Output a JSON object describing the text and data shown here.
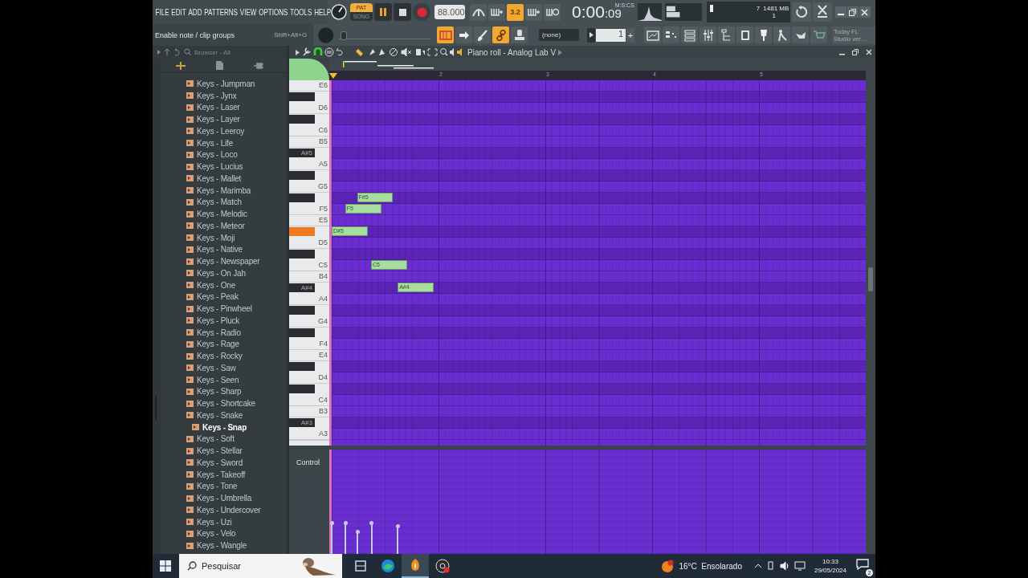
{
  "menu": [
    "FILE",
    "EDIT",
    "ADD",
    "PATTERNS",
    "VIEW",
    "OPTIONS",
    "TOOLS",
    "HELP"
  ],
  "hint": {
    "text": "Enable note / clip groups",
    "shortcut": "Shift+Alt+G"
  },
  "transport": {
    "modes": [
      {
        "label": "PAT",
        "selected": true
      },
      {
        "label": "SONG",
        "selected": false
      }
    ],
    "tempo": "88.000",
    "recording": false
  },
  "master_pitch": {
    "level": 0.02
  },
  "top_buttons": [
    {
      "kind": "metronome",
      "on": false
    },
    {
      "kind": "wait",
      "on": false
    },
    {
      "kind": "countdown",
      "label": "3.2",
      "on": true
    },
    {
      "kind": "blend",
      "on": false
    },
    {
      "kind": "loop",
      "on": false
    }
  ],
  "time": {
    "value": "0:00",
    "small": ":09",
    "unit": "M:S:CS"
  },
  "memory": {
    "voices": "7",
    "ram": "1481 MB",
    "polyphony": "1"
  },
  "tool_buttons": [
    {
      "kind": "typing",
      "on": true
    },
    {
      "kind": "arrow",
      "on": false
    },
    {
      "kind": "brush",
      "on": false
    },
    {
      "kind": "link",
      "on": true
    },
    {
      "kind": "stamp",
      "on": false
    }
  ],
  "snap": "(none)",
  "pattern": {
    "value": "1",
    "add": "+"
  },
  "window_buttons": [
    {
      "kind": "playlist"
    },
    {
      "kind": "steps"
    },
    {
      "kind": "channels"
    },
    {
      "kind": "mixer"
    },
    {
      "kind": "browser"
    },
    {
      "kind": "copy"
    },
    {
      "kind": "plugin"
    },
    {
      "kind": "person"
    },
    {
      "kind": "hand"
    },
    {
      "kind": "cart"
    }
  ],
  "news": "Today  FL Studio ver…",
  "browser": {
    "title": "Browser - All",
    "items": [
      {
        "label": "Keys - Jumpman",
        "selected": false
      },
      {
        "label": "Keys - Jynx",
        "selected": false
      },
      {
        "label": "Keys - Laser",
        "selected": false
      },
      {
        "label": "Keys - Layer",
        "selected": false
      },
      {
        "label": "Keys - Leeroy",
        "selected": false
      },
      {
        "label": "Keys - Life",
        "selected": false
      },
      {
        "label": "Keys - Loco",
        "selected": false
      },
      {
        "label": "Keys - Lucius",
        "selected": false
      },
      {
        "label": "Keys - Mallet",
        "selected": false
      },
      {
        "label": "Keys - Marimba",
        "selected": false
      },
      {
        "label": "Keys - Match",
        "selected": false
      },
      {
        "label": "Keys - Melodic",
        "selected": false
      },
      {
        "label": "Keys - Meteor",
        "selected": false
      },
      {
        "label": "Keys - Moji",
        "selected": false
      },
      {
        "label": "Keys - Native",
        "selected": false
      },
      {
        "label": "Keys - Newspaper",
        "selected": false
      },
      {
        "label": "Keys - On Jah",
        "selected": false
      },
      {
        "label": "Keys - One",
        "selected": false
      },
      {
        "label": "Keys - Peak",
        "selected": false
      },
      {
        "label": "Keys - Pinwheel",
        "selected": false
      },
      {
        "label": "Keys - Pluck",
        "selected": false
      },
      {
        "label": "Keys - Radio",
        "selected": false
      },
      {
        "label": "Keys - Rage",
        "selected": false
      },
      {
        "label": "Keys - Rocky",
        "selected": false
      },
      {
        "label": "Keys - Saw",
        "selected": false
      },
      {
        "label": "Keys - Seen",
        "selected": false
      },
      {
        "label": "Keys - Sharp",
        "selected": false
      },
      {
        "label": "Keys - Shortcake",
        "selected": false
      },
      {
        "label": "Keys - Snake",
        "selected": false
      },
      {
        "label": "Keys - Snap",
        "selected": true
      },
      {
        "label": "Keys - Soft",
        "selected": false
      },
      {
        "label": "Keys - Stellar",
        "selected": false
      },
      {
        "label": "Keys - Sword",
        "selected": false
      },
      {
        "label": "Keys - Takeoff",
        "selected": false
      },
      {
        "label": "Keys - Tone",
        "selected": false
      },
      {
        "label": "Keys - Umbrella",
        "selected": false
      },
      {
        "label": "Keys - Undercover",
        "selected": false
      },
      {
        "label": "Keys - Uzi",
        "selected": false
      },
      {
        "label": "Keys - Velo",
        "selected": false
      },
      {
        "label": "Keys - Wangle",
        "selected": false
      }
    ]
  },
  "piano_roll": {
    "title": "Piano roll - Analog Lab V",
    "bars": [
      "2",
      "3",
      "4",
      "5"
    ],
    "control_label": "Control",
    "keys": [
      {
        "label": "E6",
        "kind": "white",
        "pressed": false
      },
      {
        "kind": "black",
        "pressed": false
      },
      {
        "label": "D6",
        "kind": "white",
        "pressed": false
      },
      {
        "kind": "black",
        "pressed": false
      },
      {
        "label": "C6",
        "kind": "white",
        "pressed": false
      },
      {
        "label": "B5",
        "kind": "white",
        "pressed": false
      },
      {
        "label": "A#5",
        "kind": "black",
        "pressed": false
      },
      {
        "label": "A5",
        "kind": "white",
        "pressed": false
      },
      {
        "kind": "black",
        "pressed": false
      },
      {
        "label": "G5",
        "kind": "white",
        "pressed": false
      },
      {
        "kind": "black",
        "pressed": false,
        "notes": [
          {
            "label": "F#5"
          }
        ]
      },
      {
        "label": "F5",
        "kind": "white",
        "pressed": false,
        "notes": [
          {
            "label": "F5"
          }
        ]
      },
      {
        "label": "E5",
        "kind": "white",
        "pressed": false
      },
      {
        "kind": "black",
        "pressed": true,
        "notes": [
          {
            "label": "D#5"
          }
        ]
      },
      {
        "label": "D5",
        "kind": "white",
        "pressed": false
      },
      {
        "kind": "black",
        "pressed": false
      },
      {
        "label": "C5",
        "kind": "white",
        "pressed": false,
        "notes": [
          {
            "label": "C5"
          }
        ]
      },
      {
        "label": "B4",
        "kind": "white",
        "pressed": false
      },
      {
        "label": "A#4",
        "kind": "black",
        "pressed": false,
        "notes": [
          {
            "label": "A#4"
          }
        ]
      },
      {
        "label": "A4",
        "kind": "white",
        "pressed": false
      },
      {
        "kind": "black",
        "pressed": false
      },
      {
        "label": "G4",
        "kind": "white",
        "pressed": false
      },
      {
        "kind": "black",
        "pressed": false
      },
      {
        "label": "F4",
        "kind": "white",
        "pressed": false
      },
      {
        "label": "E4",
        "kind": "white",
        "pressed": false
      },
      {
        "kind": "black",
        "pressed": false
      },
      {
        "label": "D4",
        "kind": "white",
        "pressed": false
      },
      {
        "kind": "black",
        "pressed": false
      },
      {
        "label": "C4",
        "kind": "white",
        "pressed": false
      },
      {
        "label": "B3",
        "kind": "white",
        "pressed": false
      },
      {
        "label": "A#3",
        "kind": "black",
        "pressed": false
      },
      {
        "label": "A3",
        "kind": "white",
        "pressed": false
      }
    ]
  },
  "taskbar": {
    "search_placeholder": "Pesquisar",
    "apps": [
      {
        "kind": "taskview",
        "selected": false
      },
      {
        "kind": "edge",
        "selected": false
      },
      {
        "kind": "fl",
        "selected": true
      },
      {
        "kind": "obs",
        "selected": false
      }
    ],
    "weather": "16°C  Ensolarado",
    "time": "10:33",
    "date": "29/05/2024",
    "notifications": "2"
  }
}
